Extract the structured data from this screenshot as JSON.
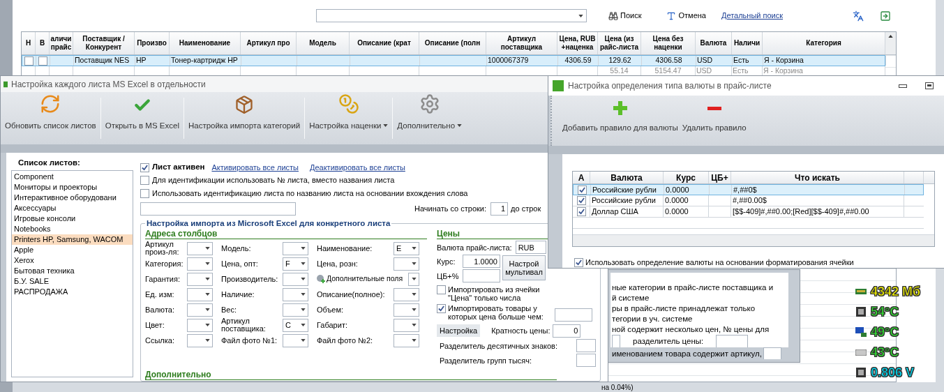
{
  "main_window": {
    "search_button": "Поиск",
    "cancel_button": "Отмена",
    "detailed_search_link": "Детальный поиск",
    "table": {
      "columns": [
        "Н",
        "В",
        "аличи прайс",
        "Поставщик / Конкурент",
        "Произво",
        "Наименование",
        "Артикул про",
        "Модель",
        "Описание (крат",
        "Описание (полн",
        "Артикул поставщика",
        "Цена, RUB +наценка",
        "Цена (из райс-листа",
        "Цена без наценки",
        "Валюта",
        "Наличи",
        "Категория"
      ],
      "rows": [
        {
          "selected": true,
          "dimmed": false,
          "cells": [
            {
              "kind": "checkbox",
              "checked": false
            },
            {
              "kind": "checkbox",
              "checked": false
            },
            null,
            "Поставщик NES",
            "HP",
            "Тонер-картридж HP",
            null,
            null,
            null,
            null,
            "1000067379",
            "4306.59",
            "129.62",
            "4306.58",
            "USD",
            "Есть",
            "Я - Корзина"
          ]
        },
        {
          "selected": false,
          "dimmed": true,
          "cells": [
            null,
            null,
            null,
            null,
            null,
            null,
            null,
            null,
            null,
            null,
            null,
            null,
            "55.14",
            "5154.47",
            "USD",
            "Есть",
            "Я - Корзина"
          ]
        }
      ]
    },
    "status_text": "на 0.04%)"
  },
  "sheet_settings_window": {
    "title": "Настройка каждого листа MS Excel в отдельности",
    "toolbar": [
      {
        "kind": "refresh",
        "label": "Обновить список листов",
        "dropdown": false
      },
      {
        "kind": "open",
        "label": "Открыть в MS Excel",
        "dropdown": false
      },
      {
        "kind": "categories",
        "label": "Настройка импорта категорий",
        "dropdown": false
      },
      {
        "kind": "markup",
        "label": "Настройка наценки",
        "dropdown": true
      },
      {
        "kind": "more",
        "label": "Дополнительно",
        "dropdown": true
      }
    ],
    "sheets_label": "Список листов:",
    "sheets": [
      {
        "label": "Component",
        "selected": false
      },
      {
        "label": "Мониторы и проекторы",
        "selected": false
      },
      {
        "label": "Интерактивное оборудовани",
        "selected": false
      },
      {
        "label": "Аксессуары",
        "selected": false
      },
      {
        "label": "Игровые консоли",
        "selected": false
      },
      {
        "label": "Notebooks",
        "selected": false
      },
      {
        "label": "Printers HP, Samsung, WACOM",
        "selected": true
      },
      {
        "label": "Apple",
        "selected": false
      },
      {
        "label": "Xerox",
        "selected": false
      },
      {
        "label": "Бытовая техника",
        "selected": false
      },
      {
        "label": "Б.У. SALE",
        "selected": false
      },
      {
        "label": "РАСПРОДАЖА",
        "selected": false
      }
    ],
    "active_checkbox": {
      "label": "Лист активен",
      "checked": true
    },
    "links": [
      "Активировать все листы",
      "Деактивировать все листы"
    ],
    "options": [
      {
        "label": "Для идентификации использовать № листа, вместо названия листа",
        "checked": false
      },
      {
        "label": "Использовать идентификацию листа по названию листа на основании вхождения слова",
        "checked": false
      }
    ],
    "start_row_label": "Начинать со строки:",
    "start_row": "1",
    "end_row_label": "до строк",
    "import_title": "Настройка импорта из Microsoft Excel для конкретного листа",
    "columns_title": "Адреса столбцов",
    "column_fields": [
      [
        {
          "label": "Артикул произ-ля:"
        },
        {
          "label": "Категория:"
        },
        {
          "label": "Гарантия:"
        },
        {
          "label": "Ед. изм:"
        },
        {
          "label": "Валюта:"
        },
        {
          "label": "Цвет:"
        },
        {
          "label": "Ссылка:"
        }
      ],
      [
        {
          "label": "Модель:"
        },
        {
          "label": "Цена, опт:",
          "value": "F"
        },
        {
          "label": "Производитель:"
        },
        {
          "label": "Наличие:"
        },
        {
          "label": "Вес:"
        },
        {
          "label": "Артикул поставщика:",
          "value": "C"
        },
        {
          "label": "Файл фото №1:"
        }
      ],
      [
        {
          "label": "Наименование:",
          "value": "E"
        },
        {
          "label": "Цена, розн:"
        },
        {
          "label": "Дополнительные поля",
          "kind": "extra"
        },
        {
          "label": "Описание(полное):"
        },
        {
          "label": "Объем:"
        },
        {
          "label": "Габарит:"
        },
        {
          "label": "Файл фото №2:"
        }
      ]
    ],
    "prices_title": "Цены",
    "currency_label": "Валюта прайс-листа:",
    "currency": "RUB",
    "rate_label": "Курс:",
    "rate": "1.0000",
    "multicurrency_button": "Настрой мультивал",
    "cb_label": "ЦБ+%",
    "price_options": [
      {
        "label": "Импортировать из ячейки \"Цена\" только числа",
        "checked": false
      },
      {
        "label": "Импортировать товары у которых цена больше чем:",
        "checked": true
      }
    ],
    "settings_button": "Настройка",
    "multiplicity_label": "Кратность цены:",
    "multiplicity": "0",
    "decimal_separator_label": "Разделитель десятичных знаков:",
    "thousands_separator_label": "Разделитель групп тысяч:",
    "extra_title": "Дополнительно"
  },
  "category_dialog": {
    "lines": [
      "ные категории в прайс-листе поставщика и",
      "й системе",
      "ры в прайс-листе принадлежат только",
      "тегории в уч. системе",
      "ной содержит несколько цен, № цены для"
    ],
    "price_separator_label": "разделитель цены:",
    "article_line": "именованием товара содержит артикул,"
  },
  "currency_dialog": {
    "title": "Настройка определения типа валюты в прайс-листе",
    "toolbar": [
      {
        "kind": "add",
        "label": "Добавить правило для валюты"
      },
      {
        "kind": "remove",
        "label": "Удалить правило"
      }
    ],
    "columns": [
      "А",
      "Валюта",
      "Курс",
      "ЦБ+",
      "Что искать"
    ],
    "rows": [
      {
        "selected": true,
        "active": true,
        "currency": "Российские рубли",
        "rate": "0.0000",
        "pattern": "#,##0$"
      },
      {
        "selected": false,
        "active": true,
        "currency": "Российские рубли",
        "rate": "0.0000",
        "pattern": "#,##0.00$"
      },
      {
        "selected": false,
        "active": true,
        "currency": "Доллар США",
        "rate": "0.0000",
        "pattern": "[$$-409]#,##0.00;[Red][$$-409]#,##0.00"
      }
    ],
    "format_checkbox": {
      "label": "Использовать определение валюты на основании форматирования ячейки",
      "checked": true
    }
  },
  "hardware_monitor": [
    {
      "kind": "memory",
      "value": "4342 Мб",
      "color": "#f2f200"
    },
    {
      "kind": "cpu",
      "value": "54°C",
      "color": "#33dd33"
    },
    {
      "kind": "display",
      "value": "49°C",
      "color": "#33dd33"
    },
    {
      "kind": "disk",
      "value": "43°C",
      "color": "#33dd33"
    },
    {
      "kind": "cpu",
      "value": "0.806 V",
      "color": "#00d8f0"
    }
  ]
}
